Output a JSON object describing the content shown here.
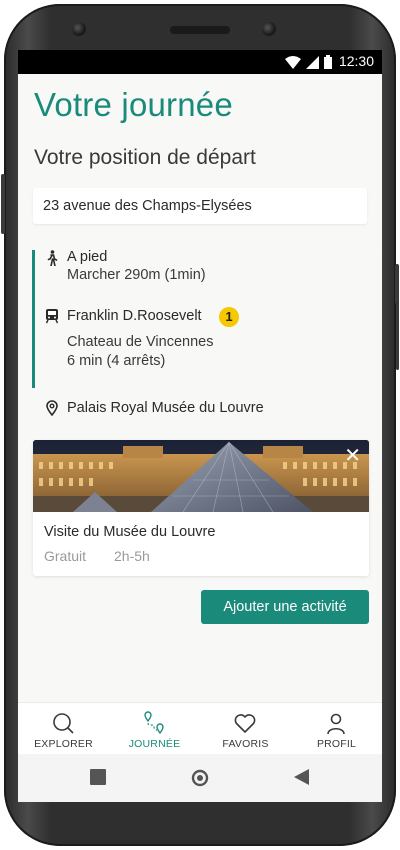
{
  "status_bar": {
    "time": "12:30",
    "icons": [
      "wifi-icon",
      "signal-icon",
      "battery-icon"
    ]
  },
  "page": {
    "title": "Votre journée",
    "subtitle": "Votre position de départ"
  },
  "start": {
    "address": "23 avenue des Champs-Elysées"
  },
  "itinerary": {
    "walk": {
      "icon": "walking-icon",
      "title": "A pied",
      "detail": "Marcher 290m (1min)"
    },
    "metro": {
      "icon": "metro-icon",
      "station": "Franklin D.Roosevelt",
      "line": "1",
      "line_color": "#f5c800",
      "direction": "Chateau de Vincennes",
      "duration": "6 min (4 arrêts)"
    },
    "destination": {
      "icon": "location-pin-icon",
      "name": "Palais Royal Musée du Louvre"
    }
  },
  "activity": {
    "title": "Visite du Musée du Louvre",
    "price": "Gratuit",
    "duration": "2h-5h",
    "close_icon": "close-icon"
  },
  "add_activity_label": "Ajouter une activité",
  "tabs": [
    {
      "label": "EXPLORER",
      "icon": "search-icon",
      "active": false
    },
    {
      "label": "JOURNÉE",
      "icon": "route-icon",
      "active": true
    },
    {
      "label": "FAVORIS",
      "icon": "heart-icon",
      "active": false
    },
    {
      "label": "PROFIL",
      "icon": "user-icon",
      "active": false
    }
  ],
  "colors": {
    "accent": "#1a8a7a",
    "background": "#f8f8f6",
    "muted_text": "#9a9a9a"
  }
}
